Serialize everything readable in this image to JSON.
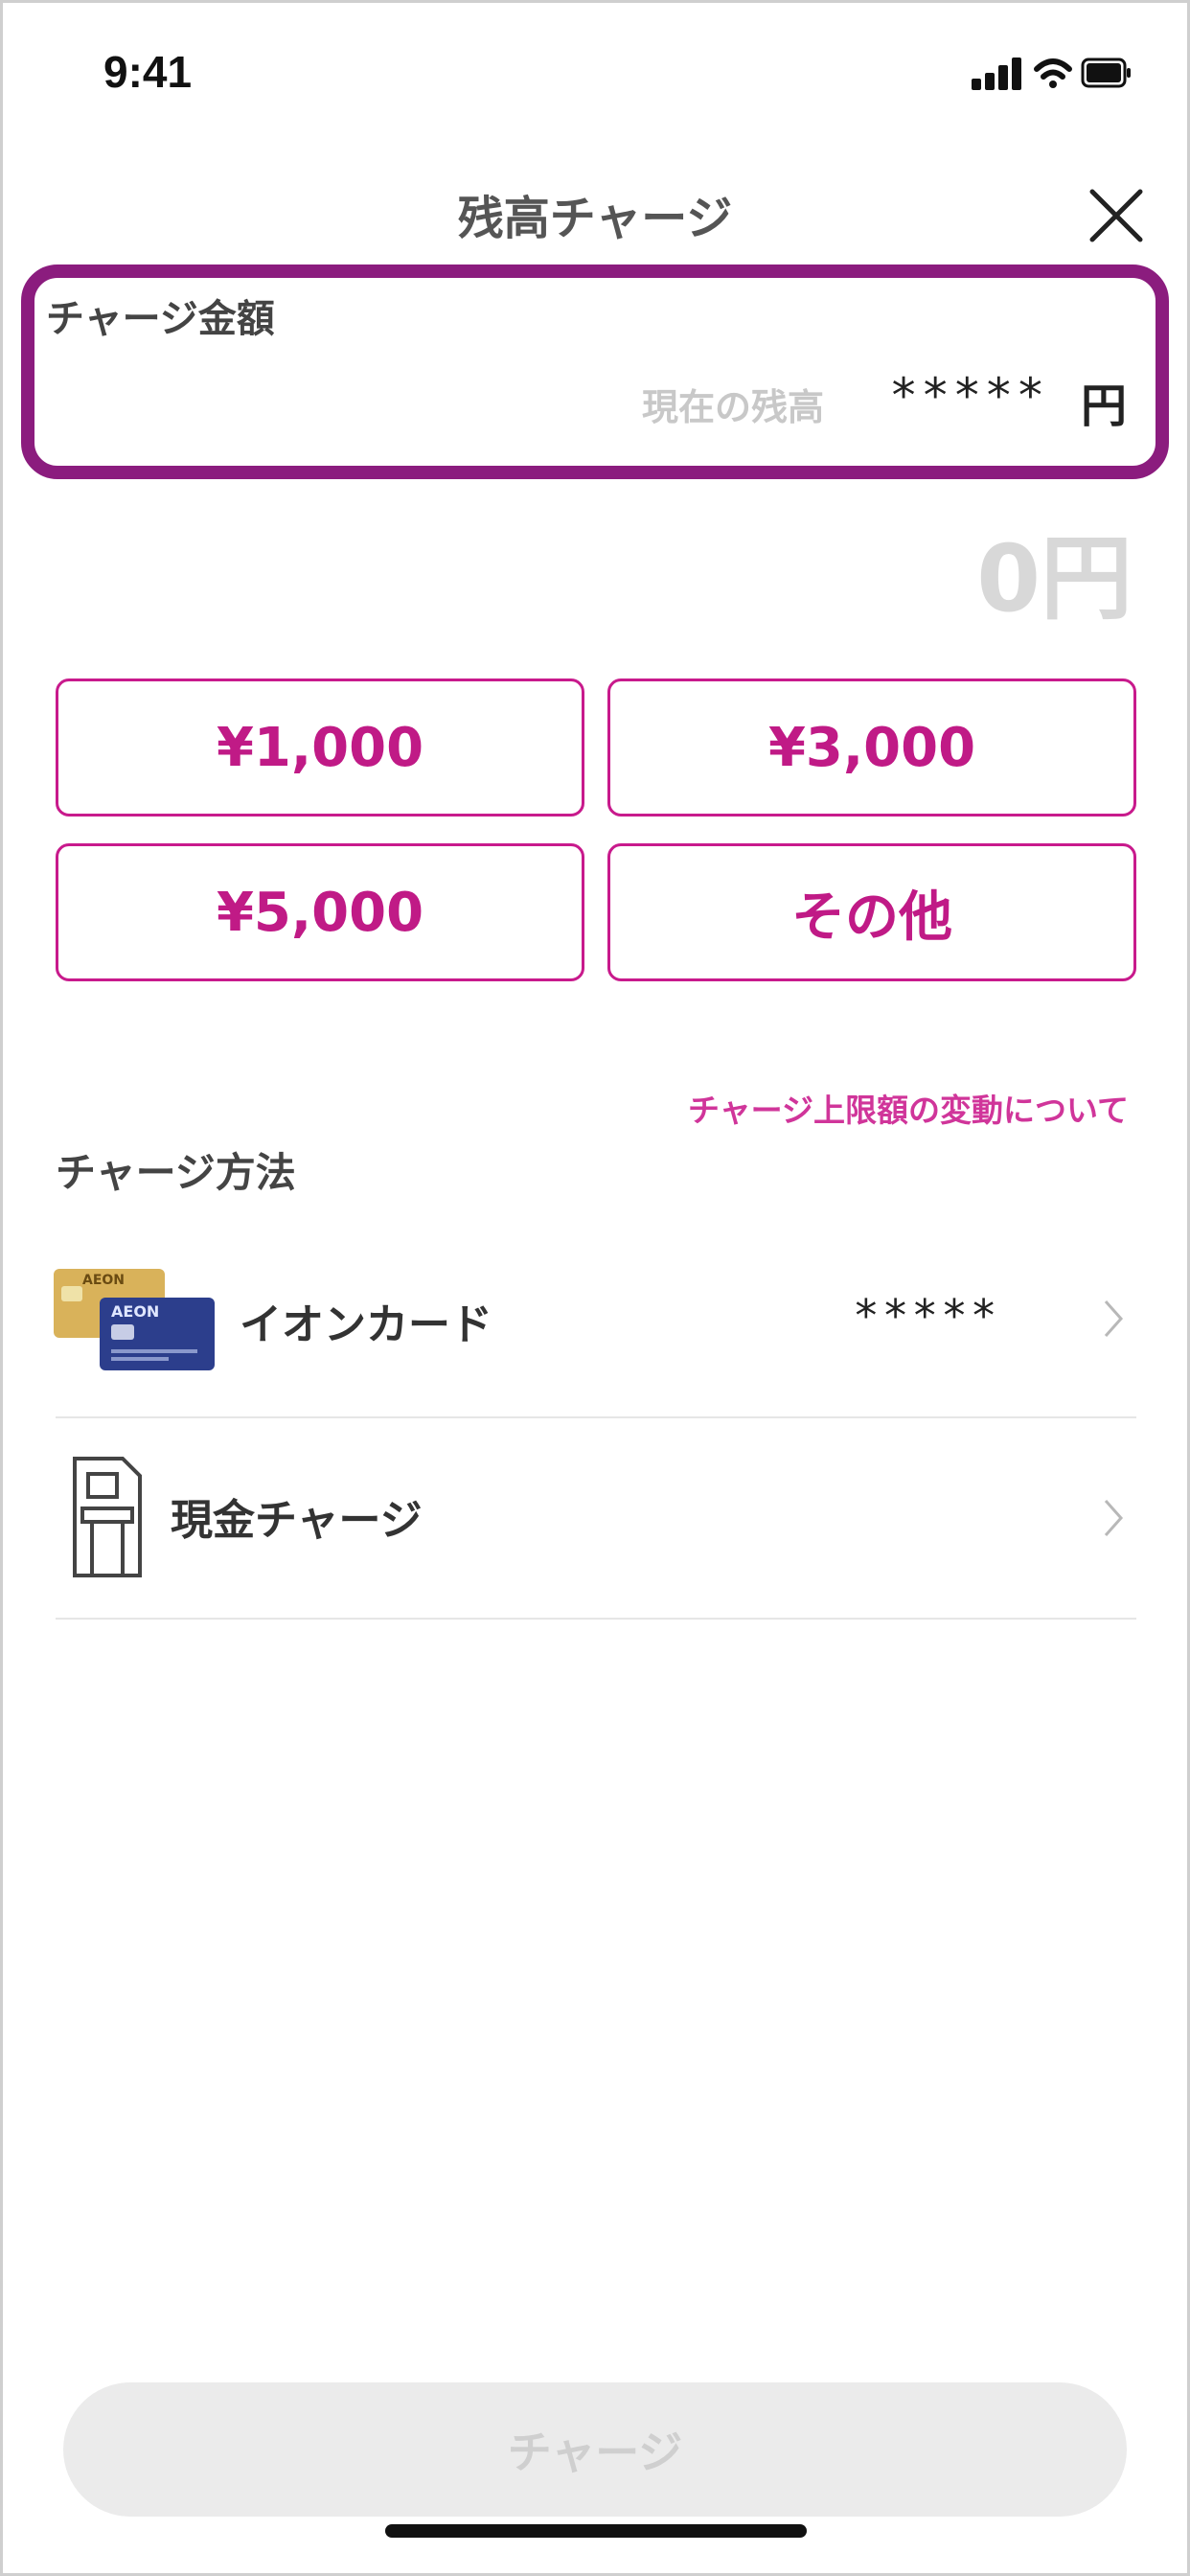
{
  "status_bar": {
    "time": "9:41"
  },
  "header": {
    "title": "残高チャージ"
  },
  "amount_section": {
    "label": "チャージ金額",
    "balance_label": "現在の残高",
    "balance_value": "*****",
    "balance_unit": "円",
    "entered_amount": "0円",
    "highlight_color": "#8b1c7e"
  },
  "presets": [
    {
      "label": "¥1,000"
    },
    {
      "label": "¥3,000"
    },
    {
      "label": "¥5,000"
    },
    {
      "label": "その他"
    }
  ],
  "limit_link": "チャージ上限額の変動について",
  "methods": {
    "title": "チャージ方法",
    "items": [
      {
        "label": "イオンカード",
        "value": "*****",
        "icon": "aeon-card-icon"
      },
      {
        "label": "現金チャージ",
        "icon": "atm-icon"
      }
    ]
  },
  "charge_button": {
    "label": "チャージ"
  },
  "colors": {
    "accent": "#c01a86",
    "disabled_bg": "#ebebeb",
    "disabled_text": "#cfcfcf"
  }
}
